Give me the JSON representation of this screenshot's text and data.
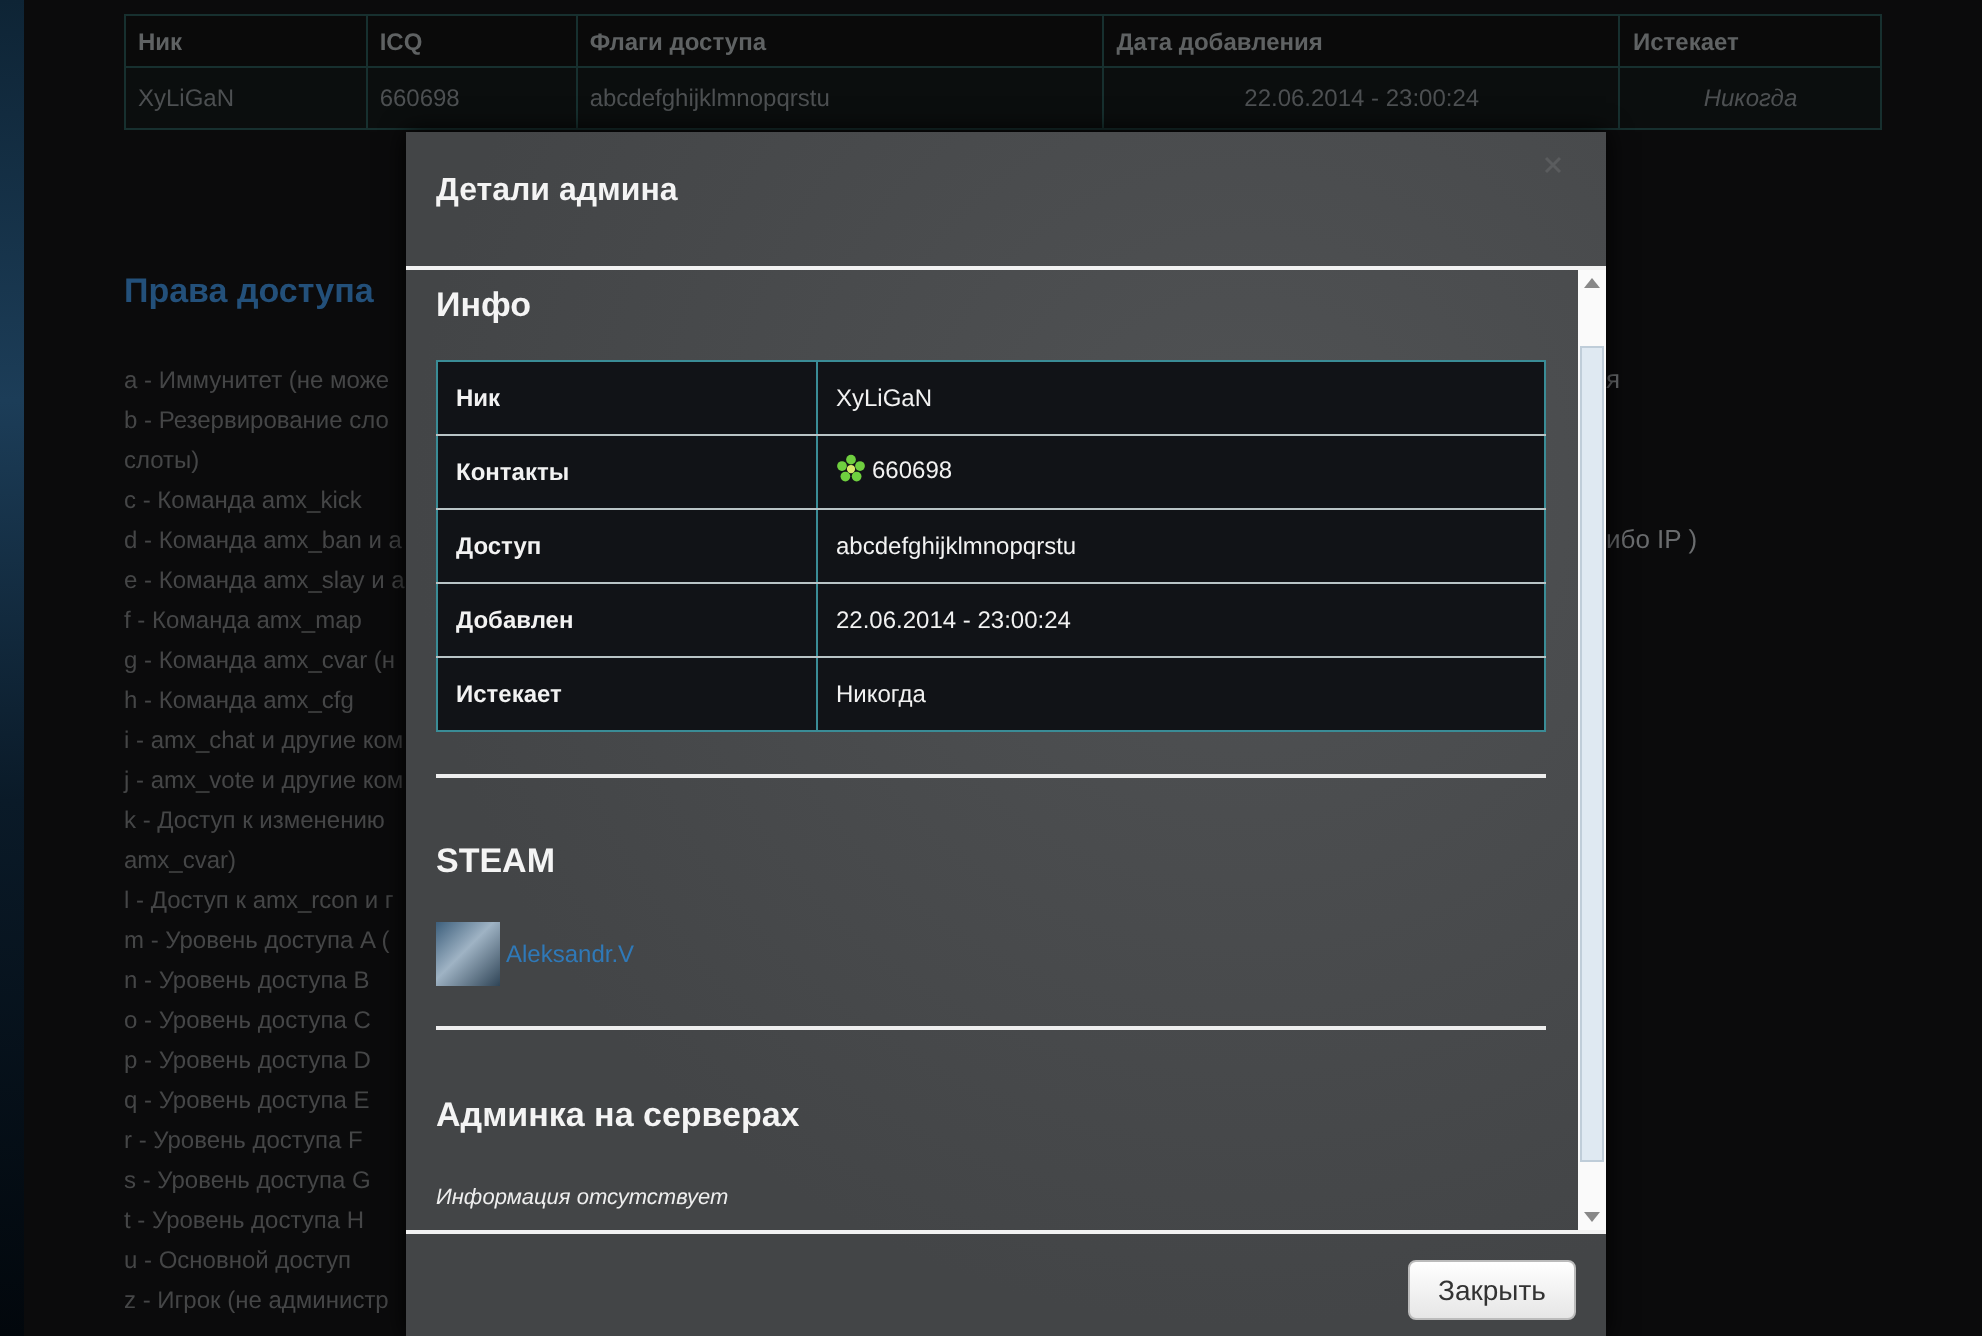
{
  "background_page": {
    "admins_table": {
      "columns": [
        "Ник",
        "ICQ",
        "Флаги доступа",
        "Дата добавления",
        "Истекает"
      ],
      "rows": [
        [
          "XyLiGaN",
          "660698",
          "abcdefghijklmnopqrstu",
          "22.06.2014 - 23:00:24",
          "Никогда"
        ]
      ]
    },
    "rights": {
      "title": "Права доступа",
      "lines": [
        {
          "text": "a - Иммунитет (не може",
          "tail": "я"
        },
        {
          "text": "b - Резервирование сло"
        },
        {
          "text": "слоты)"
        },
        {
          "text": "c - Команда amx_kick"
        },
        {
          "text": "d - Команда amx_ban и a",
          "tail": "ибо IP )"
        },
        {
          "text": "e - Команда amx_slay и a"
        },
        {
          "text": "f - Команда amx_map"
        },
        {
          "text": "g - Команда amx_cvar (н"
        },
        {
          "text": "h - Команда amx_cfg"
        },
        {
          "text": "i - amx_chat и другие ком"
        },
        {
          "text": "j - amx_vote и другие ком"
        },
        {
          "text": "k - Доступ к изменению"
        },
        {
          "text": "amx_cvar)"
        },
        {
          "text": "l - Доступ к amx_rcon и г"
        },
        {
          "text": "m - Уровень доступа A ("
        },
        {
          "text": "n - Уровень доступа B"
        },
        {
          "text": "o - Уровень доступа C"
        },
        {
          "text": "p - Уровень доступа D"
        },
        {
          "text": "q - Уровень доступа E"
        },
        {
          "text": "r - Уровень доступа F"
        },
        {
          "text": "s - Уровень доступа G"
        },
        {
          "text": "t - Уровень доступа H"
        },
        {
          "text": "u - Основной доступ"
        },
        {
          "text": "z - Игрок (не администр"
        }
      ]
    }
  },
  "modal": {
    "title": "Детали админа",
    "info": {
      "heading": "Инфо",
      "rows": [
        {
          "label": "Ник",
          "value": "XyLiGaN",
          "kind": "text"
        },
        {
          "label": "Контакты",
          "value": "660698",
          "kind": "icq"
        },
        {
          "label": "Доступ",
          "value": "abcdefghijklmnopqrstu",
          "kind": "text"
        },
        {
          "label": "Добавлен",
          "value": "22.06.2014 - 23:00:24",
          "kind": "text"
        },
        {
          "label": "Истекает",
          "value": "Никогда",
          "kind": "text"
        }
      ]
    },
    "steam": {
      "heading": "STEAM",
      "profile_name": "Aleksandr.V"
    },
    "servers": {
      "heading": "Админка на серверах",
      "note": "Информация отсутствует"
    },
    "close_button": "Закрыть"
  }
}
